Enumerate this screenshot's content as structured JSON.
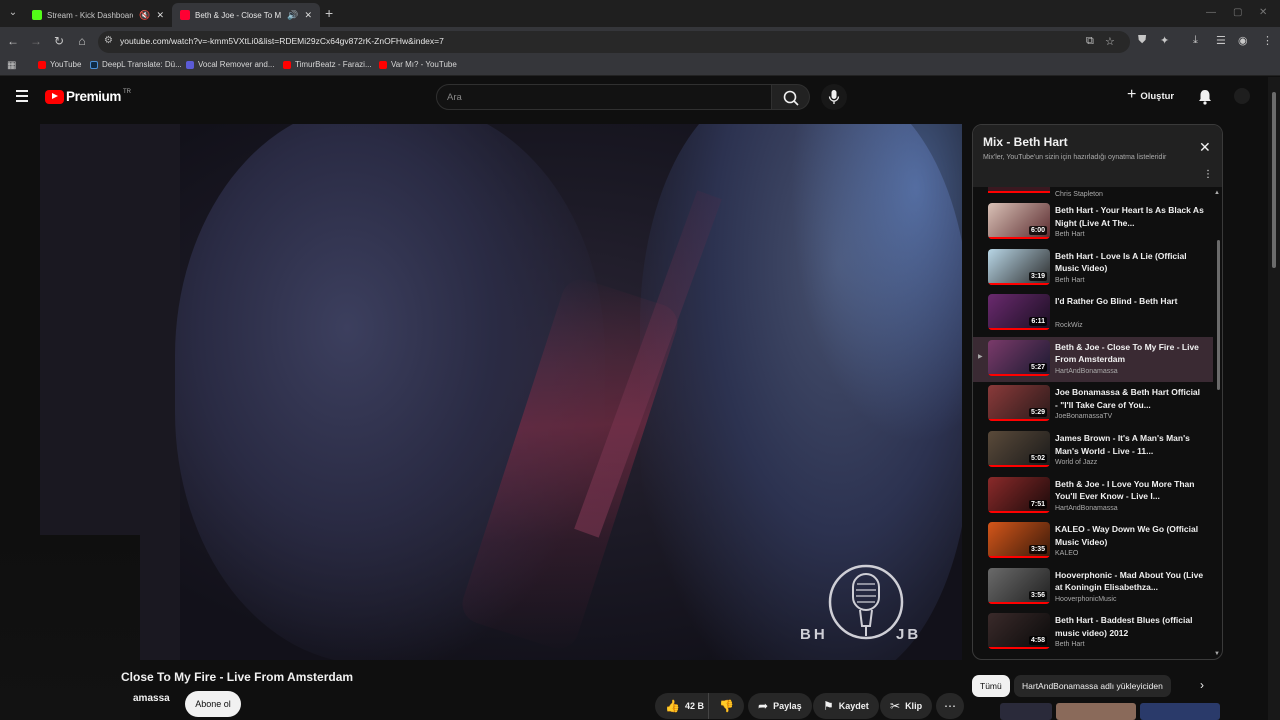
{
  "browser": {
    "tabs": [
      {
        "title": "Stream - Kick Dashboard",
        "favicon_color": "#53fc18",
        "active": false
      },
      {
        "title": "Beth & Joe - Close To My Fire",
        "favicon_color": "#ff0033",
        "active": true
      }
    ],
    "url": "youtube.com/watch?v=-kmm5VXtLi0&list=RDEMi29zCx64gv872rK-ZnOFHw&index=7",
    "bookmarks": [
      {
        "label": "YouTube",
        "color": "#ff0000"
      },
      {
        "label": "DeepL Translate: Dü...",
        "color": "#0f2b46"
      },
      {
        "label": "Vocal Remover and...",
        "color": "#5b5bd6"
      },
      {
        "label": "TimurBeatz - Farazi...",
        "color": "#ff0000"
      },
      {
        "label": "Var Mı? - YouTube",
        "color": "#ff0000"
      }
    ]
  },
  "header": {
    "logo_text": "Premium",
    "country_code": "TR",
    "search_placeholder": "Ara",
    "create_label": "Oluştur"
  },
  "video": {
    "title": "Close To My Fire - Live From Amsterdam",
    "channel": "amassa",
    "subscribe_label": "Abone ol",
    "likes": "42 B",
    "share_label": "Paylaş",
    "save_label": "Kaydet",
    "clip_label": "Klip",
    "watermark_left": "BH",
    "watermark_right": "JB"
  },
  "playlist": {
    "title": "Mix - Beth Hart",
    "subtitle": "Mix'ler, YouTube'un sizin için hazırladığı oynatma listeleridir",
    "previous_channel": "Chris Stapleton",
    "items": [
      {
        "title": "Beth Hart - Your Heart Is As Black As Night (Live At The...",
        "channel": "Beth Hart",
        "duration": "6:00",
        "thumb": [
          "#d9c1b6",
          "#5a2b2f"
        ]
      },
      {
        "title": "Beth Hart - Love Is A Lie (Official Music Video)",
        "channel": "Beth Hart",
        "duration": "3:19",
        "thumb": [
          "#b8d6e6",
          "#2a2a2a"
        ]
      },
      {
        "title": "I'd Rather Go Blind - Beth Hart",
        "channel": "RockWiz",
        "duration": "6:11",
        "thumb": [
          "#6a2a6e",
          "#1a0f22"
        ]
      },
      {
        "title": "Beth & Joe - Close To My Fire - Live From Amsterdam",
        "channel": "HartAndBonamassa",
        "duration": "5:27",
        "thumb": [
          "#7a3a6a",
          "#1a1a30"
        ],
        "active": true
      },
      {
        "title": "Joe Bonamassa & Beth Hart Official - \"I'll Take Care of You...",
        "channel": "JoeBonamassaTV",
        "duration": "5:29",
        "thumb": [
          "#8a3a3a",
          "#2a1a1a"
        ]
      },
      {
        "title": "James Brown - It's A Man's Man's Man's World - Live - 11...",
        "channel": "World of Jazz",
        "duration": "5:02",
        "thumb": [
          "#5a4a3a",
          "#1a1a1a"
        ]
      },
      {
        "title": "Beth & Joe - I Love You More Than You'll Ever Know - Live I...",
        "channel": "HartAndBonamassa",
        "duration": "7:51",
        "thumb": [
          "#8a2a2a",
          "#1a0a0a"
        ]
      },
      {
        "title": "KALEO - Way Down We Go (Official Music Video)",
        "channel": "KALEO",
        "duration": "3:35",
        "thumb": [
          "#d4561a",
          "#3a1a0a"
        ]
      },
      {
        "title": "Hooverphonic - Mad About You (Live at Koningin Elisabethza...",
        "channel": "HooverphonicMusic",
        "duration": "3:56",
        "thumb": [
          "#6a6a6a",
          "#202020"
        ]
      },
      {
        "title": "Beth Hart - Baddest Blues (official music video) 2012",
        "channel": "Beth Hart",
        "duration": "4:58",
        "thumb": [
          "#3a2a2a",
          "#0a0a0a"
        ]
      }
    ]
  },
  "chips": {
    "all_label": "Tümü",
    "uploader_label": "HartAndBonamassa adlı yükleyiciden"
  },
  "colors": {
    "brand_red": "#ff0000",
    "background": "#0f0f0f",
    "panel_header": "#212121"
  }
}
